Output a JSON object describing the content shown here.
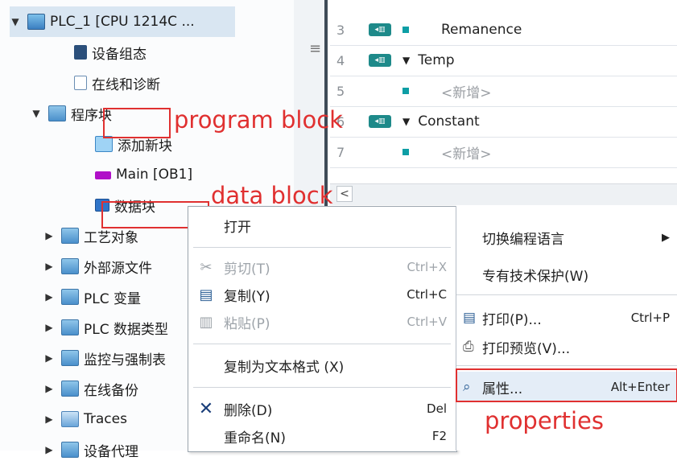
{
  "tree": {
    "items": [
      {
        "label": "PLC_1 [CPU 1214C ...",
        "arrow": "▼",
        "icon": "cpu-icon"
      },
      {
        "label": "设备组态",
        "arrow": "",
        "icon": "device-config-icon"
      },
      {
        "label": "在线和诊断",
        "arrow": "",
        "icon": "online-diagnostics-icon"
      },
      {
        "label": "程序块",
        "arrow": "▼",
        "icon": "program-blocks-folder-icon"
      },
      {
        "label": "添加新块",
        "arrow": "",
        "icon": "add-block-icon"
      },
      {
        "label": "Main [OB1]",
        "arrow": "",
        "icon": "ob-block-icon"
      },
      {
        "label": "数据块",
        "arrow": "",
        "icon": "data-block-icon"
      },
      {
        "label": "工艺对象",
        "arrow": "▶",
        "icon": "tech-objects-folder-icon"
      },
      {
        "label": "外部源文件",
        "arrow": "▶",
        "icon": "external-sources-folder-icon"
      },
      {
        "label": "PLC 变量",
        "arrow": "▶",
        "icon": "plc-tags-folder-icon"
      },
      {
        "label": "PLC 数据类型",
        "arrow": "▶",
        "icon": "plc-data-types-folder-icon"
      },
      {
        "label": "监控与强制表",
        "arrow": "▶",
        "icon": "watch-tables-folder-icon"
      },
      {
        "label": "在线备份",
        "arrow": "▶",
        "icon": "online-backup-folder-icon"
      },
      {
        "label": "Traces",
        "arrow": "▶",
        "icon": "traces-folder-icon"
      },
      {
        "label": "设备代理",
        "arrow": "▶",
        "icon": "device-proxy-folder-icon"
      }
    ]
  },
  "grid": {
    "rows": [
      {
        "num": "3",
        "tag": true,
        "chev": "",
        "text": "Remanence",
        "muted": false,
        "indent": true
      },
      {
        "num": "4",
        "tag": true,
        "chev": "▼",
        "text": "Temp",
        "muted": false,
        "indent": false
      },
      {
        "num": "5",
        "tag": false,
        "chev": "",
        "text": "<新增>",
        "muted": true,
        "indent": true
      },
      {
        "num": "6",
        "tag": true,
        "chev": "▼",
        "text": "Constant",
        "muted": false,
        "indent": false
      },
      {
        "num": "7",
        "tag": false,
        "chev": "",
        "text": "<新增>",
        "muted": true,
        "indent": true
      }
    ],
    "scroll_left": "<"
  },
  "menu1": {
    "open": "打开",
    "cut": "剪切(T)",
    "cut_short": "Ctrl+X",
    "copy": "复制(Y)",
    "copy_short": "Ctrl+C",
    "paste": "粘贴(P)",
    "paste_short": "Ctrl+V",
    "copy_text": "复制为文本格式 (X)",
    "delete": "删除(D)",
    "delete_short": "Del",
    "rename": "重命名(N)",
    "rename_short": "F2"
  },
  "menu2": {
    "switch_lang": "切换编程语言",
    "know_how": "专有技术保护(W)",
    "print": "打印(P)...",
    "print_short": "Ctrl+P",
    "print_preview": "打印预览(V)...",
    "properties": "属性...",
    "properties_short": "Alt+Enter"
  },
  "annotations": {
    "program_block": "program block",
    "data_block": "data block",
    "properties": "properties"
  },
  "colors": {
    "annotation": "#e03030",
    "selection": "#d9e6f2",
    "tag": "#1e8a8a"
  }
}
